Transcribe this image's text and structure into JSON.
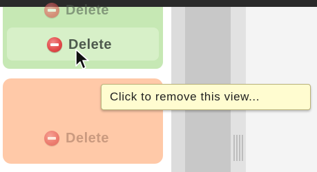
{
  "rows": [
    {
      "label": "Delete",
      "icon": "minus-circle-icon",
      "state": "faded"
    },
    {
      "label": "Delete",
      "icon": "minus-circle-icon",
      "state": "hovered"
    },
    {
      "label": "Delete",
      "icon": "minus-circle-icon",
      "state": "faded"
    }
  ],
  "tooltip": {
    "text": "Click to remove this view..."
  },
  "colors": {
    "green_card": "#c6e8b4",
    "green_row_highlight": "#d7f0c8",
    "orange_card": "#ffc9a8",
    "delete_icon_red": "#e24b4b",
    "tooltip_bg": "#fffcd0"
  }
}
